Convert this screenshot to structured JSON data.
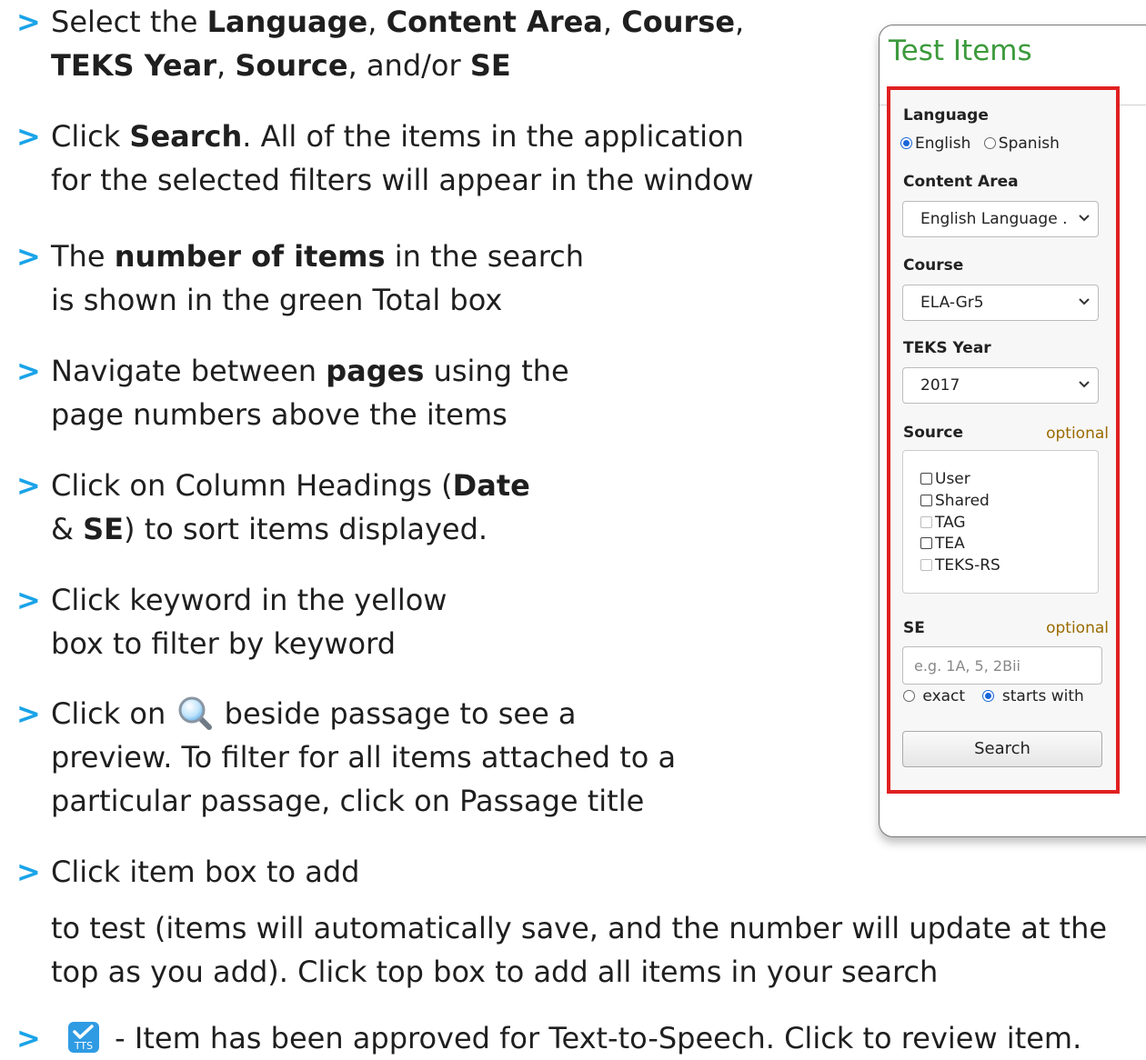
{
  "instructions": [
    {
      "lines": [
        [
          {
            "t": "Select the "
          },
          {
            "b": "Language"
          },
          {
            "t": ", "
          },
          {
            "b": "Content Area"
          },
          {
            "t": ", "
          },
          {
            "b": "Course"
          },
          {
            "t": ","
          }
        ],
        [
          {
            "b": "TEKS Year"
          },
          {
            "t": ", "
          },
          {
            "b": "Source"
          },
          {
            "t": ", and/or "
          },
          {
            "b": "SE"
          }
        ]
      ]
    },
    {
      "lines": [
        [
          {
            "t": "Click "
          },
          {
            "b": "Search"
          },
          {
            "t": ".  All of the items in the application"
          }
        ],
        [
          {
            "t": "for the selected filters will appear in the window"
          }
        ]
      ]
    },
    {
      "lines": [
        [
          {
            "t": "The "
          },
          {
            "b": "number of items"
          },
          {
            "t": " in the search"
          }
        ],
        [
          {
            "t": "is shown in the green Total box"
          }
        ]
      ]
    },
    {
      "lines": [
        [
          {
            "t": "Navigate between "
          },
          {
            "b": "pages"
          },
          {
            "t": " using the"
          }
        ],
        [
          {
            "t": "page numbers above the items"
          }
        ]
      ]
    },
    {
      "lines": [
        [
          {
            "t": "Click on Column Headings ("
          },
          {
            "b": "Date"
          }
        ],
        [
          {
            "t": "& "
          },
          {
            "b": "SE"
          },
          {
            "t": ") to sort items displayed."
          }
        ]
      ]
    },
    {
      "lines": [
        [
          {
            "t": "Click keyword in the yellow"
          }
        ],
        [
          {
            "t": "box to filter by keyword"
          }
        ]
      ]
    },
    {
      "lines": [
        [
          {
            "t": "Click on "
          },
          {
            "icon": "magnifier"
          },
          {
            "t": " beside passage to see a"
          }
        ],
        [
          {
            "t": "preview.  To filter for all items attached to a"
          }
        ],
        [
          {
            "t": "particular passage, click on Passage title"
          }
        ]
      ]
    },
    {
      "lines": [
        [
          {
            "t": "Click item box to add"
          }
        ],
        [
          {
            "t": ""
          }
        ],
        [
          {
            "t": "to test (items will automatically save, and the number will update at the"
          }
        ],
        [
          {
            "t": "top as you add).  Click top box to add all items in your search"
          }
        ]
      ]
    },
    {
      "lines": [
        [
          {
            "icon": "tts"
          },
          {
            "t": " - Item has been approved for Text-to-Speech.  Click to review item."
          }
        ]
      ]
    }
  ],
  "icons": {
    "magnifier": "magnifier-icon",
    "tts": "tts-icon",
    "arrow": "chevron-right-icon"
  },
  "colors": {
    "arrow": "#1aa3e8",
    "title": "#3c9a3c",
    "highlight": "#e02020",
    "optional": "#9a6a00"
  },
  "panel": {
    "title": "Test Items",
    "language": {
      "label": "Language",
      "options": [
        "English",
        "Spanish"
      ],
      "selected": "English"
    },
    "content_area": {
      "label": "Content Area",
      "value": "English Language ."
    },
    "course": {
      "label": "Course",
      "value": "ELA-Gr5"
    },
    "teks_year": {
      "label": "TEKS Year",
      "value": "2017"
    },
    "source": {
      "label": "Source",
      "optional": "optional",
      "options": [
        {
          "label": "User",
          "enabled": true
        },
        {
          "label": "Shared",
          "enabled": true
        },
        {
          "label": "TAG",
          "enabled": false
        },
        {
          "label": "TEA",
          "enabled": true
        },
        {
          "label": "TEKS-RS",
          "enabled": false
        }
      ]
    },
    "se": {
      "label": "SE",
      "optional": "optional",
      "placeholder": "e.g. 1A, 5, 2Bii",
      "value": "",
      "match_options": [
        "exact",
        "starts with"
      ],
      "match_selected": "starts with"
    },
    "search_label": "Search"
  }
}
